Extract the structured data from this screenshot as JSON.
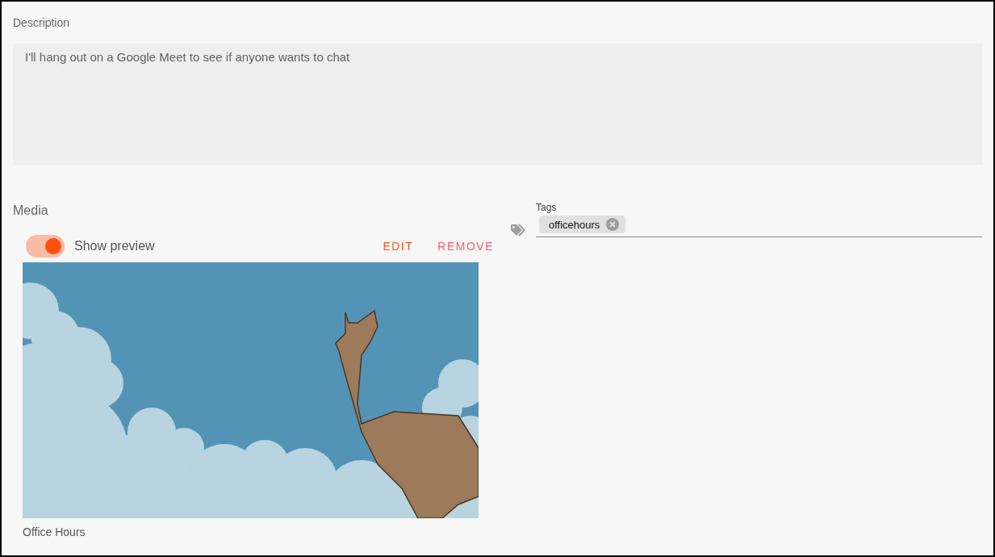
{
  "description": {
    "label": "Description",
    "value": "I'll hang out on a Google Meet to see if anyone wants to chat"
  },
  "media": {
    "label": "Media",
    "show_preview": {
      "label": "Show preview",
      "on": true
    },
    "actions": [
      {
        "label": "EDIT",
        "kind": "edit"
      },
      {
        "label": "REMOVE",
        "kind": "remove"
      }
    ],
    "caption": "Office Hours"
  },
  "tags": {
    "label": "Tags",
    "chips": [
      {
        "label": "officehours"
      }
    ]
  }
}
